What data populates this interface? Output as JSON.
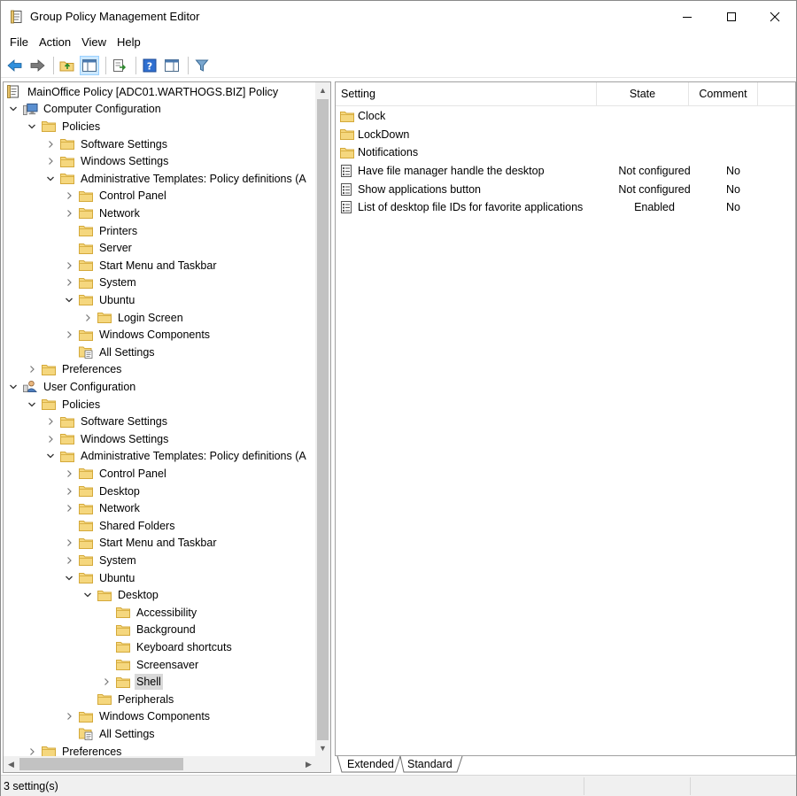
{
  "window": {
    "title": "Group Policy Management Editor"
  },
  "menu": {
    "items": [
      "File",
      "Action",
      "View",
      "Help"
    ]
  },
  "tree": {
    "rows": [
      {
        "label": "MainOffice Policy [ADC01.WARTHOGS.BIZ] Policy",
        "level": 0,
        "twisty": "none",
        "icon": "gpo"
      },
      {
        "label": "Computer Configuration",
        "level": 0,
        "twisty": "expanded",
        "icon": "computer"
      },
      {
        "label": "Policies",
        "level": 1,
        "twisty": "expanded",
        "icon": "folder"
      },
      {
        "label": "Software Settings",
        "level": 2,
        "twisty": "collapsed",
        "icon": "folder"
      },
      {
        "label": "Windows Settings",
        "level": 2,
        "twisty": "collapsed",
        "icon": "folder"
      },
      {
        "label": "Administrative Templates: Policy definitions (A",
        "level": 2,
        "twisty": "expanded",
        "icon": "folder"
      },
      {
        "label": "Control Panel",
        "level": 3,
        "twisty": "collapsed",
        "icon": "folder"
      },
      {
        "label": "Network",
        "level": 3,
        "twisty": "collapsed",
        "icon": "folder"
      },
      {
        "label": "Printers",
        "level": 3,
        "twisty": "none",
        "icon": "folder"
      },
      {
        "label": "Server",
        "level": 3,
        "twisty": "none",
        "icon": "folder"
      },
      {
        "label": "Start Menu and Taskbar",
        "level": 3,
        "twisty": "collapsed",
        "icon": "folder"
      },
      {
        "label": "System",
        "level": 3,
        "twisty": "collapsed",
        "icon": "folder"
      },
      {
        "label": "Ubuntu",
        "level": 3,
        "twisty": "expanded",
        "icon": "folder"
      },
      {
        "label": "Login Screen",
        "level": 4,
        "twisty": "collapsed",
        "icon": "folder"
      },
      {
        "label": "Windows Components",
        "level": 3,
        "twisty": "collapsed",
        "icon": "folder"
      },
      {
        "label": "All Settings",
        "level": 3,
        "twisty": "none",
        "icon": "allsettings"
      },
      {
        "label": "Preferences",
        "level": 1,
        "twisty": "collapsed",
        "icon": "folder"
      },
      {
        "label": "User Configuration",
        "level": 0,
        "twisty": "expanded",
        "icon": "user"
      },
      {
        "label": "Policies",
        "level": 1,
        "twisty": "expanded",
        "icon": "folder"
      },
      {
        "label": "Software Settings",
        "level": 2,
        "twisty": "collapsed",
        "icon": "folder"
      },
      {
        "label": "Windows Settings",
        "level": 2,
        "twisty": "collapsed",
        "icon": "folder"
      },
      {
        "label": "Administrative Templates: Policy definitions (A",
        "level": 2,
        "twisty": "expanded",
        "icon": "folder"
      },
      {
        "label": "Control Panel",
        "level": 3,
        "twisty": "collapsed",
        "icon": "folder"
      },
      {
        "label": "Desktop",
        "level": 3,
        "twisty": "collapsed",
        "icon": "folder"
      },
      {
        "label": "Network",
        "level": 3,
        "twisty": "collapsed",
        "icon": "folder"
      },
      {
        "label": "Shared Folders",
        "level": 3,
        "twisty": "none",
        "icon": "folder"
      },
      {
        "label": "Start Menu and Taskbar",
        "level": 3,
        "twisty": "collapsed",
        "icon": "folder"
      },
      {
        "label": "System",
        "level": 3,
        "twisty": "collapsed",
        "icon": "folder"
      },
      {
        "label": "Ubuntu",
        "level": 3,
        "twisty": "expanded",
        "icon": "folder"
      },
      {
        "label": "Desktop",
        "level": 4,
        "twisty": "expanded",
        "icon": "folder"
      },
      {
        "label": "Accessibility",
        "level": 5,
        "twisty": "none",
        "icon": "folder"
      },
      {
        "label": "Background",
        "level": 5,
        "twisty": "none",
        "icon": "folder"
      },
      {
        "label": "Keyboard shortcuts",
        "level": 5,
        "twisty": "none",
        "icon": "folder"
      },
      {
        "label": "Screensaver",
        "level": 5,
        "twisty": "none",
        "icon": "folder"
      },
      {
        "label": "Shell",
        "level": 5,
        "twisty": "collapsed",
        "icon": "folder",
        "selected": true
      },
      {
        "label": "Peripherals",
        "level": 4,
        "twisty": "none",
        "icon": "folder"
      },
      {
        "label": "Windows Components",
        "level": 3,
        "twisty": "collapsed",
        "icon": "folder"
      },
      {
        "label": "All Settings",
        "level": 3,
        "twisty": "none",
        "icon": "allsettings"
      },
      {
        "label": "Preferences",
        "level": 1,
        "twisty": "collapsed",
        "icon": "folder"
      }
    ]
  },
  "detail": {
    "columns": {
      "setting": "Setting",
      "state": "State",
      "comment": "Comment"
    },
    "rows": [
      {
        "setting": "Clock",
        "state": "",
        "comment": "",
        "icon": "folder"
      },
      {
        "setting": "LockDown",
        "state": "",
        "comment": "",
        "icon": "folder"
      },
      {
        "setting": "Notifications",
        "state": "",
        "comment": "",
        "icon": "folder"
      },
      {
        "setting": "Have file manager handle the desktop",
        "state": "Not configured",
        "comment": "No",
        "icon": "policy"
      },
      {
        "setting": "Show applications button",
        "state": "Not configured",
        "comment": "No",
        "icon": "policy"
      },
      {
        "setting": "List of desktop file IDs for favorite applications",
        "state": "Enabled",
        "comment": "No",
        "icon": "policy"
      }
    ]
  },
  "tabs": {
    "extended": "Extended",
    "standard": "Standard",
    "active": "standard"
  },
  "status": {
    "text": "3 setting(s)"
  },
  "colors": {
    "folder": "#f5d77e",
    "folderEdge": "#d4a93a",
    "selection": "#d9d9d9",
    "scrollThumb": "#c2c2c2"
  }
}
